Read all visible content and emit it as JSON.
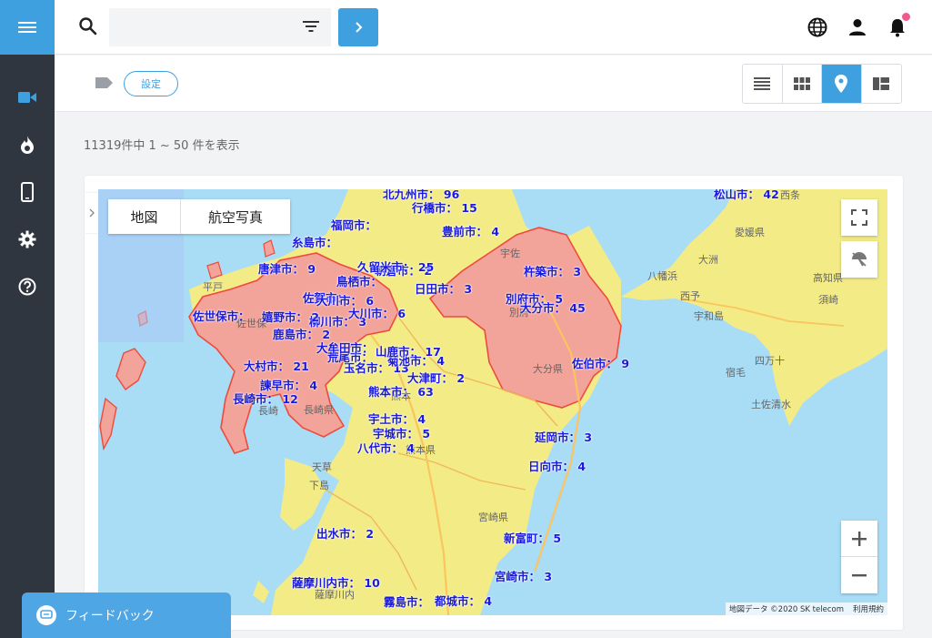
{
  "header": {
    "search_placeholder": "",
    "icons": [
      "menu-icon",
      "search-icon",
      "filter-icon",
      "chevron-right-icon",
      "globe-icon",
      "person-icon",
      "bell-icon"
    ]
  },
  "sidebar": {
    "items": [
      {
        "icon": "videocam-icon"
      },
      {
        "icon": "flame-icon"
      },
      {
        "icon": "smartphone-icon"
      },
      {
        "icon": "gear-icon"
      },
      {
        "icon": "help-icon"
      }
    ]
  },
  "toolbar": {
    "settings_label": "設定",
    "views": [
      "list-view",
      "grid-view",
      "map-view",
      "tile-view"
    ],
    "active_view": "map-view"
  },
  "result_count": "11319件中 1 ~ 50 件を表示",
  "map": {
    "type_tabs": [
      "地図",
      "航空写真"
    ],
    "zoom_in": "+",
    "zoom_out": "−",
    "attribution": "地図データ ©2020 SK telecom",
    "terms": "利用規約",
    "colors": {
      "sea": "#a9dcf5",
      "land": "#f3ec86",
      "highlight": "#f2a39a",
      "label": "#1a1adf"
    },
    "place_labels": [
      {
        "text": "西条"
      },
      {
        "text": "愛媛県"
      },
      {
        "text": "大洲"
      },
      {
        "text": "八幡浜"
      },
      {
        "text": "西予"
      },
      {
        "text": "宇和島"
      },
      {
        "text": "四万十"
      },
      {
        "text": "宿毛"
      },
      {
        "text": "土佐清水"
      },
      {
        "text": "高知県"
      },
      {
        "text": "須崎"
      },
      {
        "text": "大分県"
      },
      {
        "text": "熊本"
      },
      {
        "text": "熊本県"
      },
      {
        "text": "長崎県"
      },
      {
        "text": "長崎"
      },
      {
        "text": "宮崎県"
      },
      {
        "text": "天草"
      },
      {
        "text": "下島"
      },
      {
        "text": "薩摩川内"
      },
      {
        "text": "宇佐"
      },
      {
        "text": "別府"
      },
      {
        "text": "平戸"
      },
      {
        "text": "佐世保"
      }
    ],
    "city_labels": [
      {
        "text": "松山市：",
        "count": "42"
      },
      {
        "text": "豊前市：",
        "count": "4"
      },
      {
        "text": "杵築市：",
        "count": "3"
      },
      {
        "text": "別府市：",
        "count": "5"
      },
      {
        "text": "大分市：",
        "count": "45"
      },
      {
        "text": "佐伯市：",
        "count": "9"
      },
      {
        "text": "延岡市：",
        "count": "3"
      },
      {
        "text": "日向市：",
        "count": "4"
      },
      {
        "text": "新富町：",
        "count": "5"
      },
      {
        "text": "宮崎市：",
        "count": "3"
      },
      {
        "text": "都城市：",
        "count": "4"
      },
      {
        "text": "霧島市：",
        "count": ""
      },
      {
        "text": "薩摩川内市：",
        "count": "10"
      },
      {
        "text": "出水市：",
        "count": "2"
      },
      {
        "text": "八代市：",
        "count": "4"
      },
      {
        "text": "宇城市：",
        "count": "5"
      },
      {
        "text": "宇土市：",
        "count": "4"
      },
      {
        "text": "熊本市：",
        "count": "63"
      },
      {
        "text": "大津町：",
        "count": "2"
      },
      {
        "text": "玉名市：",
        "count": "13"
      },
      {
        "text": "菊池市：",
        "count": "4"
      },
      {
        "text": "山鹿市：",
        "count": "17"
      },
      {
        "text": "荒尾市：",
        "count": ""
      },
      {
        "text": "大牟田市：",
        "count": ""
      },
      {
        "text": "柳川市：",
        "count": "3"
      },
      {
        "text": "大川市：",
        "count": "6"
      },
      {
        "text": "鹿島市：",
        "count": "2"
      },
      {
        "text": "嬉野市：",
        "count": "2"
      },
      {
        "text": "佐世保市：",
        "count": ""
      },
      {
        "text": "大村市：",
        "count": "21"
      },
      {
        "text": "諫早市：",
        "count": "4"
      },
      {
        "text": "長崎市：",
        "count": "12"
      },
      {
        "text": "唐津市：",
        "count": "9"
      },
      {
        "text": "日田市：",
        "count": "3"
      },
      {
        "text": "朝倉市：",
        "count": "2"
      },
      {
        "text": "糸島市：",
        "count": ""
      },
      {
        "text": "行橋市：",
        "count": "15"
      },
      {
        "text": "北九州市：",
        "count": "96"
      },
      {
        "text": "福岡市：",
        "count": ""
      },
      {
        "text": "佐賀市：",
        "count": ""
      },
      {
        "text": "鳥栖市：",
        "count": ""
      },
      {
        "text": "久留米市：",
        "count": "25"
      },
      {
        "text": "大川市：",
        "count": "6"
      }
    ]
  },
  "feedback": {
    "label": "フィードバック"
  }
}
